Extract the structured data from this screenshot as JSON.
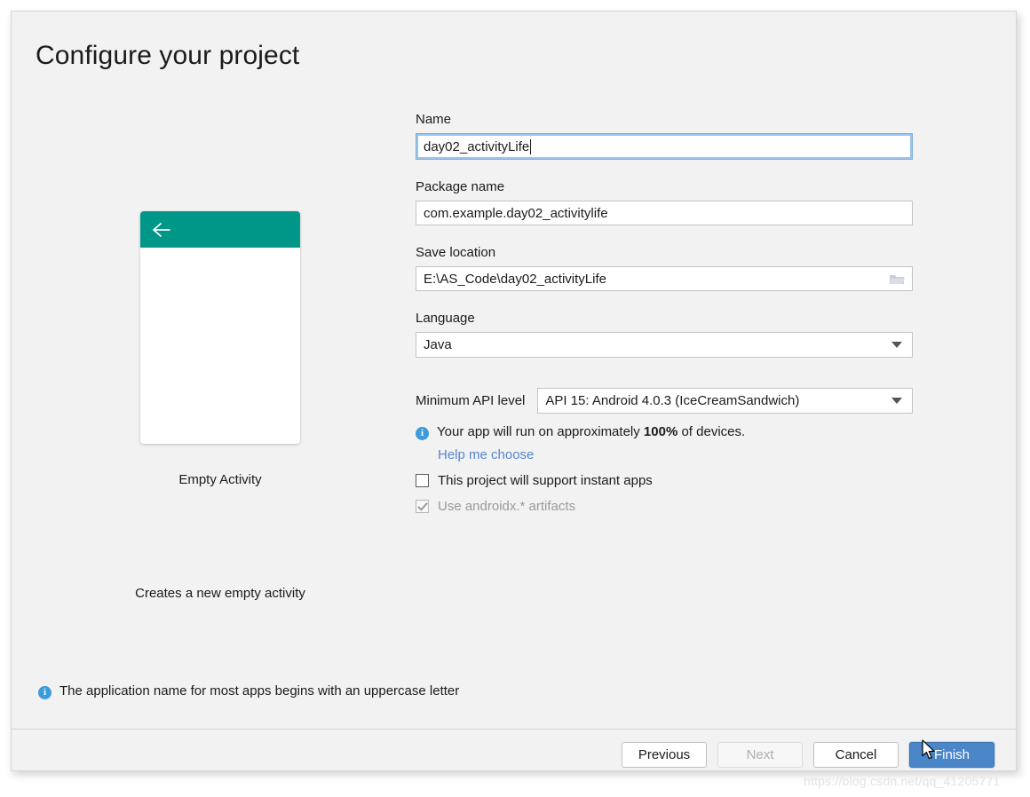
{
  "dialog": {
    "title": "Configure your project"
  },
  "preview": {
    "template_name": "Empty Activity",
    "template_description": "Creates a new empty activity",
    "appbar_color": "#009688",
    "back_icon": "arrow-left-icon"
  },
  "form": {
    "name": {
      "label": "Name",
      "value": "day02_activityLife",
      "focused": true
    },
    "package_name": {
      "label": "Package name",
      "value": "com.example.day02_activitylife"
    },
    "save_location": {
      "label": "Save location",
      "value": "E:\\AS_Code\\day02_activityLife",
      "browse_icon": "folder-icon"
    },
    "language": {
      "label": "Language",
      "value": "Java"
    },
    "minimum_api": {
      "label": "Minimum API level",
      "value": "API 15: Android 4.0.3 (IceCreamSandwich)"
    },
    "api_info": {
      "icon": "info-icon",
      "text_before": "Your app will run on approximately ",
      "percent": "100%",
      "text_after": " of devices."
    },
    "help_link": "Help me choose",
    "instant_apps_checkbox": {
      "label": "This project will support instant apps",
      "checked": false,
      "enabled": true
    },
    "androidx_checkbox": {
      "label": "Use androidx.* artifacts",
      "checked": true,
      "enabled": false
    }
  },
  "status": {
    "icon": "info-icon",
    "message": "The application name for most apps begins with an uppercase letter"
  },
  "footer": {
    "previous_label": "Previous",
    "next_label": "Next",
    "cancel_label": "Cancel",
    "finish_label": "Finish"
  },
  "watermark": "https://blog.csdn.net/qq_41205771",
  "colors": {
    "accent_teal": "#009688",
    "primary_button": "#4a86c8",
    "link": "#5585cf",
    "info": "#3d9bdc"
  }
}
